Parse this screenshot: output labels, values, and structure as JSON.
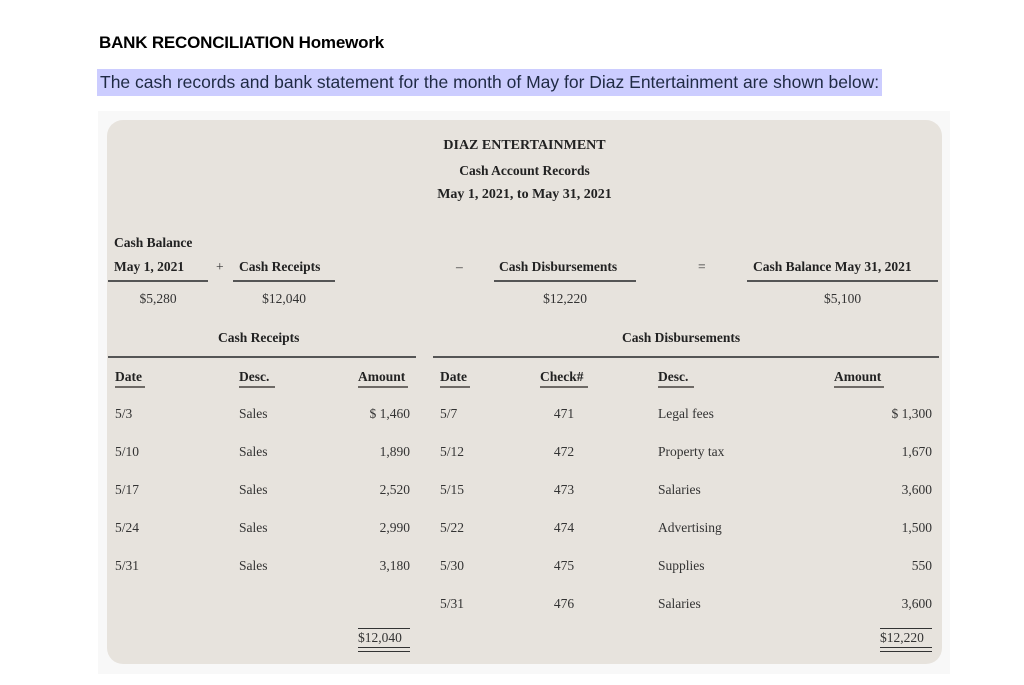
{
  "document": {
    "title": "BANK RECONCILIATION Homework",
    "intro": "The cash records and bank statement for the month of May for Diaz Entertainment are shown below:",
    "highlight_color": "#cccdff",
    "panel_color": "#e7e3dd"
  },
  "statement": {
    "company": "DIAZ ENTERTAINMENT",
    "subtitle": "Cash Account Records",
    "period": "May 1, 2021, to May 31, 2021"
  },
  "summary": {
    "begin_label_1": "Cash Balance",
    "begin_label_2": "May 1, 2021",
    "plus": "+",
    "receipts_label": "Cash Receipts",
    "minus": "–",
    "disbursements_label": "Cash Disbursements",
    "equals": "=",
    "end_label": "Cash Balance May 31, 2021",
    "begin_value": "$5,280",
    "receipts_value": "$12,040",
    "disbursements_value": "$12,220",
    "end_value": "$5,100"
  },
  "receipts": {
    "section_title": "Cash Receipts",
    "headers": {
      "date": "Date",
      "desc": "Desc.",
      "amount": "Amount"
    },
    "rows": [
      {
        "date": "5/3",
        "desc": "Sales",
        "amount": "$ 1,460"
      },
      {
        "date": "5/10",
        "desc": "Sales",
        "amount": "1,890"
      },
      {
        "date": "5/17",
        "desc": "Sales",
        "amount": "2,520"
      },
      {
        "date": "5/24",
        "desc": "Sales",
        "amount": "2,990"
      },
      {
        "date": "5/31",
        "desc": "Sales",
        "amount": "3,180"
      }
    ],
    "total": "$12,040"
  },
  "disbursements": {
    "section_title": "Cash Disbursements",
    "headers": {
      "date": "Date",
      "check": "Check#",
      "desc": "Desc.",
      "amount": "Amount"
    },
    "rows": [
      {
        "date": "5/7",
        "check": "471",
        "desc": "Legal fees",
        "amount": "$ 1,300"
      },
      {
        "date": "5/12",
        "check": "472",
        "desc": "Property tax",
        "amount": "1,670"
      },
      {
        "date": "5/15",
        "check": "473",
        "desc": "Salaries",
        "amount": "3,600"
      },
      {
        "date": "5/22",
        "check": "474",
        "desc": "Advertising",
        "amount": "1,500"
      },
      {
        "date": "5/30",
        "check": "475",
        "desc": "Supplies",
        "amount": "550"
      },
      {
        "date": "5/31",
        "check": "476",
        "desc": "Salaries",
        "amount": "3,600"
      }
    ],
    "total": "$12,220"
  }
}
